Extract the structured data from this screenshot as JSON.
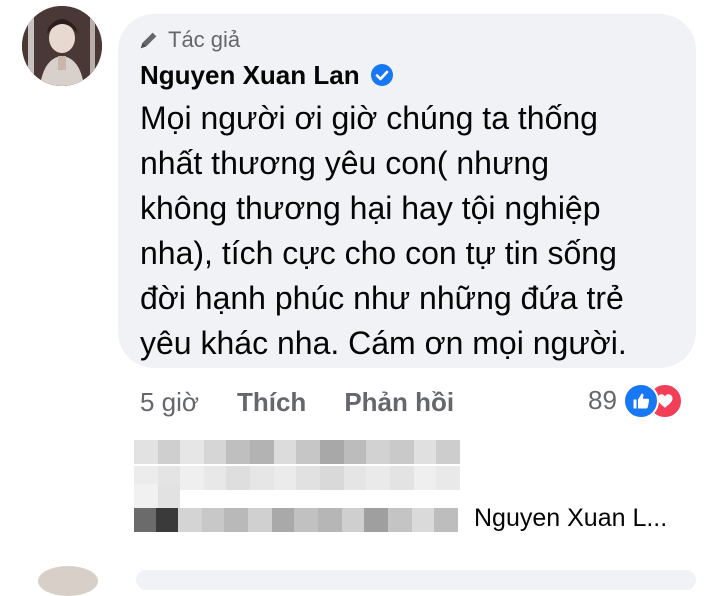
{
  "comment": {
    "author_tag": "Tác giả",
    "author_name": "Nguyen Xuan Lan",
    "text_lines": [
      "Mọi người ơi giờ chúng ta thống",
      "nhất thương yêu con( nhưng",
      "không thương hại hay tội nghiệp",
      "nha), tích cực cho con tự tin sống",
      "đời hạnh phúc như những đứa trẻ",
      "yêu khác nha. Cám ơn mọi người."
    ],
    "time": "5 giờ",
    "like_label": "Thích",
    "reply_label": "Phản hồi",
    "reaction_count": "89",
    "reaction_icons": [
      "like-icon",
      "love-icon"
    ]
  },
  "reply_preview": {
    "author_name": "Nguyen Xuan L..."
  },
  "colors": {
    "bubble": "#f0f2f5",
    "secondary_text": "#65676b",
    "like_blue": "#1877f2",
    "love_red": "#f33e58"
  }
}
